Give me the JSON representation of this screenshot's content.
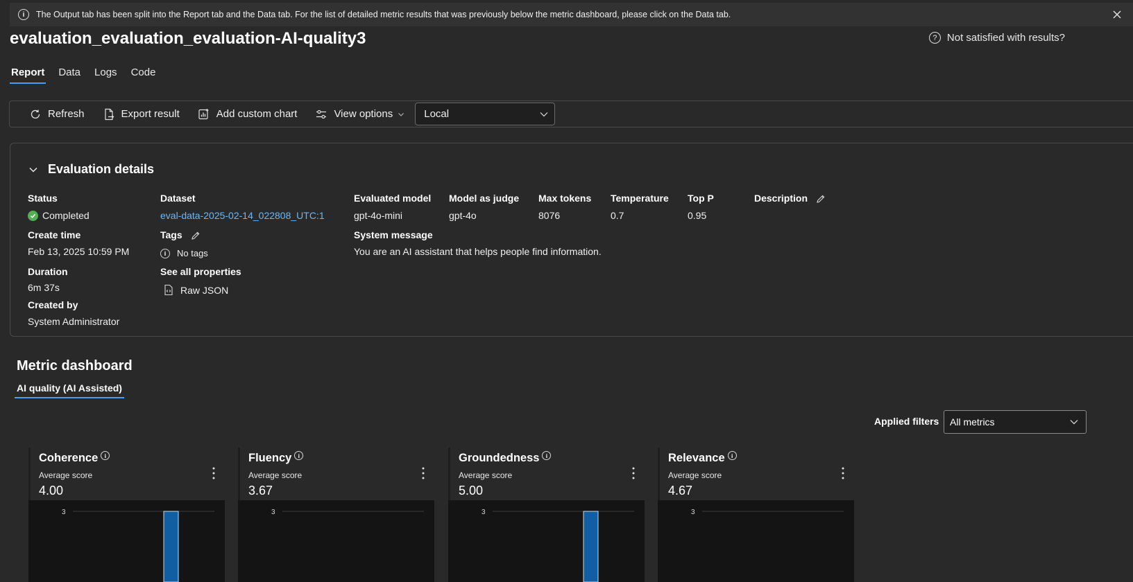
{
  "banner": {
    "message": "The Output tab has been split into the Report tab and the Data tab. For the list of detailed metric results that was previously below the metric dashboard, please click on the Data tab."
  },
  "page": {
    "title": "evaluation_evaluation_evaluation-AI-quality3",
    "help_link": "Not satisfied with results?"
  },
  "tabs": [
    {
      "label": "Report",
      "active": true
    },
    {
      "label": "Data",
      "active": false
    },
    {
      "label": "Logs",
      "active": false
    },
    {
      "label": "Code",
      "active": false
    }
  ],
  "toolbar": {
    "refresh": "Refresh",
    "export": "Export result",
    "add_chart": "Add custom chart",
    "view_options": "View options",
    "location_select": "Local"
  },
  "details": {
    "header": "Evaluation details",
    "status_label": "Status",
    "status_value": "Completed",
    "create_time_label": "Create time",
    "create_time_value": "Feb 13, 2025 10:59 PM",
    "duration_label": "Duration",
    "duration_value": "6m 37s",
    "created_by_label": "Created by",
    "created_by_value": "System Administrator",
    "dataset_label": "Dataset",
    "dataset_value": "eval-data-2025-02-14_022808_UTC:1",
    "tags_label": "Tags",
    "tags_value": "No tags",
    "properties_label": "See all properties",
    "raw_json": "Raw JSON",
    "model_label": "Evaluated model",
    "model_value": "gpt-4o-mini",
    "judge_label": "Model as judge",
    "judge_value": "gpt-4o",
    "max_tokens_label": "Max tokens",
    "max_tokens_value": "8076",
    "temperature_label": "Temperature",
    "temperature_value": "0.7",
    "top_p_label": "Top P",
    "top_p_value": "0.95",
    "description_label": "Description",
    "system_message_label": "System message",
    "system_message_value": "You are an AI assistant that helps people find information."
  },
  "dashboard": {
    "title": "Metric dashboard",
    "tab": "AI quality (AI Assisted)",
    "filters_label": "Applied filters",
    "filters_value": "All metrics"
  },
  "metrics": [
    {
      "name": "Coherence",
      "sub": "Average score",
      "score": "4.00",
      "tick": "3",
      "bar_value": 3
    },
    {
      "name": "Fluency",
      "sub": "Average score",
      "score": "3.67",
      "tick": "3",
      "bar_value": null
    },
    {
      "name": "Groundedness",
      "sub": "Average score",
      "score": "5.00",
      "tick": "3",
      "bar_value": 3
    },
    {
      "name": "Relevance",
      "sub": "Average score",
      "score": "4.67",
      "tick": "3",
      "bar_value": null
    }
  ],
  "colors": {
    "accent": "#479ef5",
    "link": "#6cb8f6",
    "success": "#54b054",
    "bar": "#115ea3"
  }
}
